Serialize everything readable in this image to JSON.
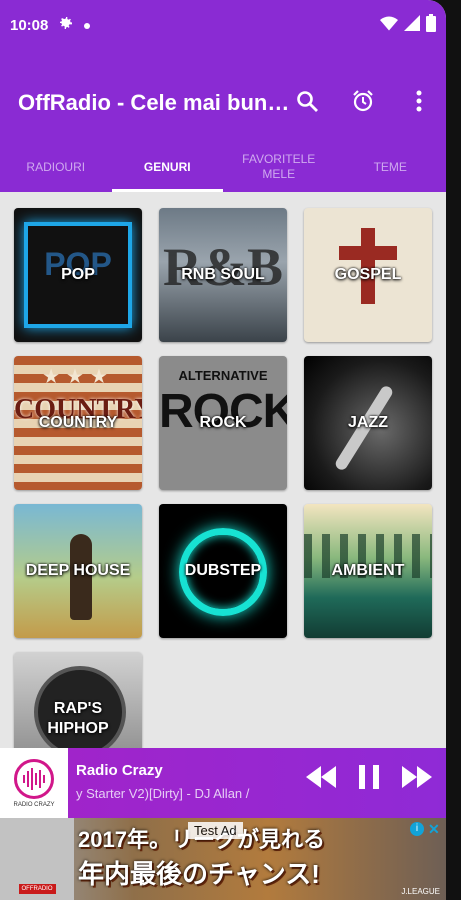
{
  "status_bar": {
    "time": "10:08"
  },
  "app_bar": {
    "title": "OffRadio - Cele mai bun…"
  },
  "tabs": [
    {
      "label": "RADIOURI"
    },
    {
      "label": "GENURI"
    },
    {
      "label": "FAVORITELE MELE"
    },
    {
      "label": "TEME"
    }
  ],
  "genres": [
    {
      "label": "POP",
      "art_text": "POP"
    },
    {
      "label": "RNB SOUL",
      "art_text": "R&B"
    },
    {
      "label": "GOSPEL"
    },
    {
      "label": "COUNTRY",
      "art_text": "COUNTRY"
    },
    {
      "label": "ROCK",
      "art_text": "ROCK",
      "art_small": "ALTERNATIVE"
    },
    {
      "label": "JAZZ"
    },
    {
      "label": "DEEP HOUSE"
    },
    {
      "label": "DUBSTEP"
    },
    {
      "label": "AMBIENT"
    },
    {
      "label": "RAP'S HIPHOP"
    }
  ],
  "player": {
    "station": "Radio Crazy",
    "track": "y Starter V2)[Dirty] - DJ Allan / ",
    "logo_caption": "RADIO CRAZY"
  },
  "ad": {
    "label": "Test Ad",
    "line1": "2017年。リーグが見れる",
    "line2": "年内最後のチャンス!",
    "brand": "J.LEAGUE"
  },
  "colors": {
    "primary": "#8a2bd3",
    "accent_tab_inactive": "#cfa9ef",
    "player_gradient_start": "#a323c8"
  },
  "icons": [
    "settings-icon",
    "dot-icon",
    "wifi-icon",
    "signal-icon",
    "battery-icon",
    "search-icon",
    "alarm-icon",
    "more-vert-icon",
    "previous-icon",
    "pause-icon",
    "next-icon",
    "close-icon",
    "info-icon"
  ]
}
